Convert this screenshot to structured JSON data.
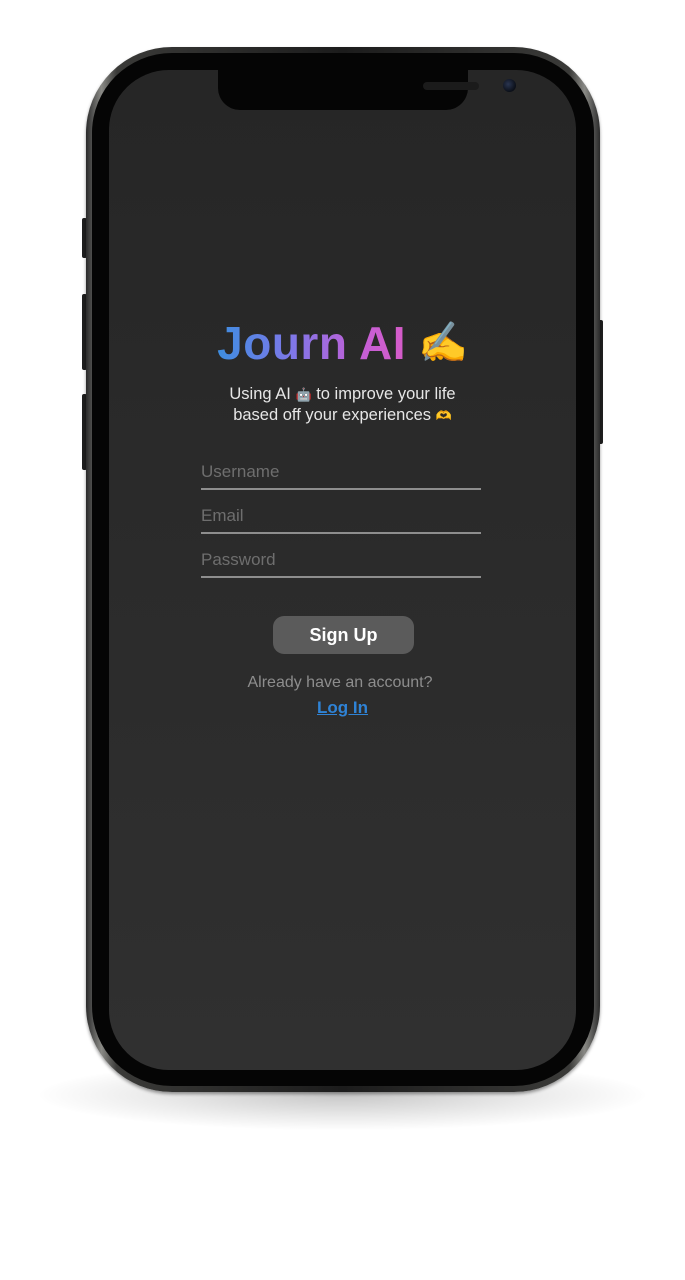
{
  "app": {
    "title": "Journ AI",
    "title_emoji": "✍️",
    "subtitle_line1_a": "Using AI ",
    "subtitle_line1_emoji": "🤖",
    "subtitle_line1_b": " to improve your life",
    "subtitle_line2": "based off your experiences ",
    "subtitle_line2_emoji": "🫶"
  },
  "form": {
    "username_placeholder": "Username",
    "email_placeholder": "Email",
    "password_placeholder": "Password",
    "signup_label": "Sign Up"
  },
  "footer": {
    "prompt": "Already have an account?",
    "login_label": "Log In"
  },
  "colors": {
    "screen_bg": "#2b2b2b",
    "title_gradient_start": "#3d8ee0",
    "title_gradient_end": "#d65cc8",
    "button_bg": "#5b5b5b",
    "link": "#2f83d6"
  }
}
